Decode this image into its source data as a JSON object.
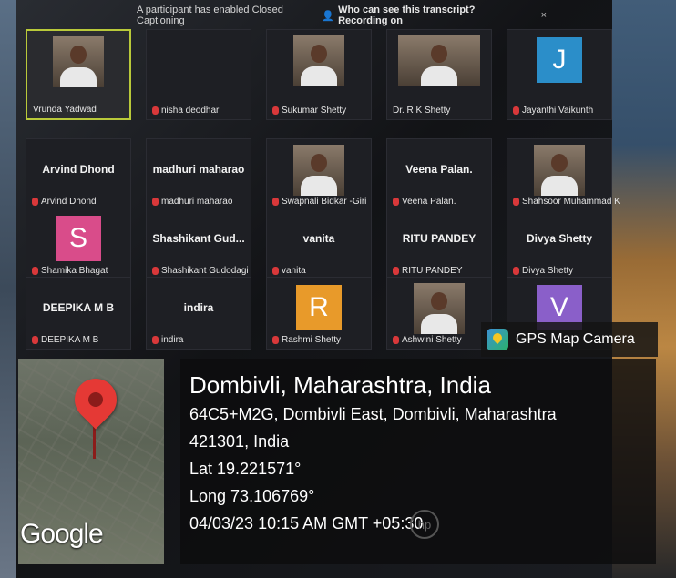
{
  "topbar": {
    "captioning": "A participant has enabled Closed Captioning",
    "question": "Who can see this transcript? Recording on",
    "close": "×"
  },
  "tiles": [
    {
      "name": "Vrunda Yadwad",
      "type": "photo",
      "active": true
    },
    {
      "name": "nisha deodhar",
      "type": "blank",
      "muted": true
    },
    {
      "name": "Sukumar Shetty",
      "type": "photo",
      "muted": true
    },
    {
      "name": "Dr. R K Shetty",
      "type": "photo-wide"
    },
    {
      "name": "Jayanthi Vaikunth",
      "type": "avatar",
      "letter": "J",
      "color": "#2b8ec9",
      "muted": true
    },
    {
      "center": "Arvind Dhond",
      "name": "Arvind Dhond",
      "muted": true
    },
    {
      "center": "madhuri maharao",
      "name": "madhuri maharao",
      "muted": true
    },
    {
      "name": "Swapnali Bidkar -Giri",
      "type": "photo",
      "muted": true
    },
    {
      "center": "Veena Palan.",
      "name": "Veena Palan.",
      "muted": true
    },
    {
      "name": "Shahsoor Muhammad K",
      "type": "photo",
      "muted": true
    },
    {
      "name": "Shamika Bhagat",
      "type": "avatar",
      "letter": "S",
      "color": "#d94c8a",
      "muted": true
    },
    {
      "center": "Shashikant Gud...",
      "name": "Shashikant Gudodagi",
      "muted": true
    },
    {
      "center": "vanita",
      "name": "vanita",
      "muted": true
    },
    {
      "center": "RITU PANDEY",
      "name": "RITU PANDEY",
      "muted": true
    },
    {
      "center": "Divya Shetty",
      "name": "Divya Shetty",
      "muted": true
    },
    {
      "center": "DEEPIKA M B",
      "name": "DEEPIKA M B",
      "muted": true
    },
    {
      "center": "indira",
      "name": "indira",
      "muted": true
    },
    {
      "name": "Rashmi Shetty",
      "type": "avatar",
      "letter": "R",
      "color": "#e89a2a",
      "muted": true
    },
    {
      "name": "Ashwini Shetty",
      "type": "photo",
      "muted": true
    },
    {
      "name": "",
      "type": "avatar",
      "letter": "V",
      "color": "#8a5fc9"
    }
  ],
  "gps": {
    "badge": "GPS Map Camera",
    "place": "Dombivli, Maharashtra, India",
    "address1": "64C5+M2G, Dombivli East, Dombivli, Maharashtra",
    "address2": "421301, India",
    "lat": "Lat 19.221571°",
    "long": "Long 73.106769°",
    "datetime": "04/03/23 10:15 AM GMT +05:30",
    "map_brand": "Google"
  },
  "colors": {
    "pin": "#e53935",
    "active_border": "#b9c93a"
  }
}
